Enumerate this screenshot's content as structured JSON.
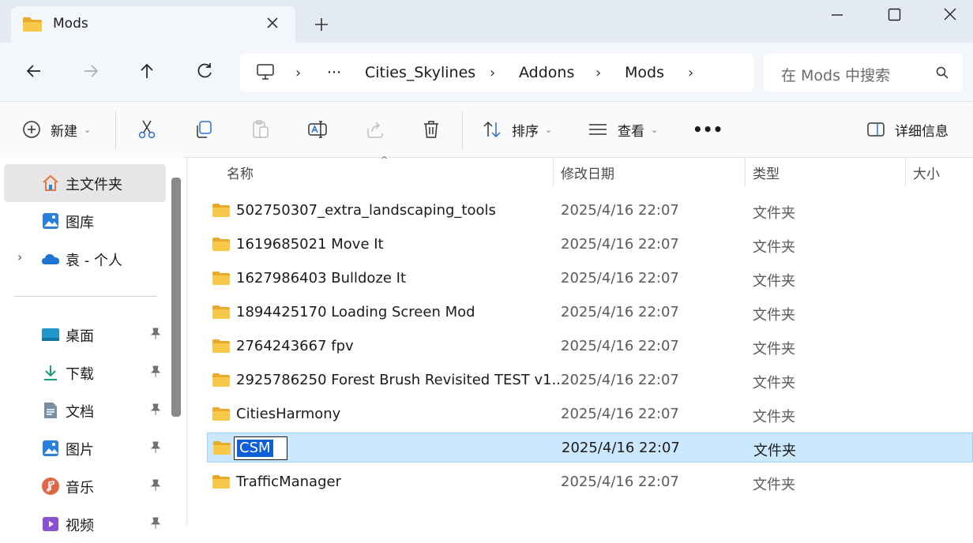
{
  "window": {
    "tab_title": "Mods",
    "controls": [
      "minimize-icon",
      "maximize-icon",
      "close-icon"
    ]
  },
  "address": {
    "ellipsis": "···",
    "crumbs": [
      "Cities_Skylines",
      "Addons",
      "Mods"
    ],
    "search_placeholder": "在 Mods 中搜索"
  },
  "toolbar": {
    "new_label": "新建",
    "sort_label": "排序",
    "view_label": "查看",
    "more_label": "•••",
    "details_label": "详细信息"
  },
  "sidebar": {
    "items": [
      {
        "label": "主文件夹",
        "icon": "home-icon"
      },
      {
        "label": "图库",
        "icon": "gallery-icon"
      },
      {
        "label": "袁 - 个人",
        "icon": "onedrive-icon"
      }
    ],
    "pinned": [
      {
        "label": "桌面",
        "icon": "desktop-icon"
      },
      {
        "label": "下载",
        "icon": "download-icon"
      },
      {
        "label": "文档",
        "icon": "documents-icon"
      },
      {
        "label": "图片",
        "icon": "pictures-icon"
      },
      {
        "label": "音乐",
        "icon": "music-icon"
      },
      {
        "label": "视频",
        "icon": "video-icon"
      }
    ]
  },
  "columns": {
    "name": "名称",
    "modified": "修改日期",
    "type": "类型",
    "size": "大小"
  },
  "files": [
    {
      "name": "502750307_extra_landscaping_tools",
      "modified": "2025/4/16 22:07",
      "type": "文件夹"
    },
    {
      "name": "1619685021 Move It",
      "modified": "2025/4/16 22:07",
      "type": "文件夹"
    },
    {
      "name": "1627986403 Bulldoze It",
      "modified": "2025/4/16 22:07",
      "type": "文件夹"
    },
    {
      "name": "1894425170 Loading Screen Mod",
      "modified": "2025/4/16 22:07",
      "type": "文件夹"
    },
    {
      "name": "2764243667 fpv",
      "modified": "2025/4/16 22:07",
      "type": "文件夹"
    },
    {
      "name": "2925786250 Forest Brush Revisited TEST v1....",
      "modified": "2025/4/16 22:07",
      "type": "文件夹"
    },
    {
      "name": "CitiesHarmony",
      "modified": "2025/4/16 22:07",
      "type": "文件夹"
    },
    {
      "name": "CSM",
      "modified": "2025/4/16 22:07",
      "type": "文件夹"
    },
    {
      "name": "TrafficManager",
      "modified": "2025/4/16 22:07",
      "type": "文件夹"
    }
  ],
  "colors": {
    "accent": "#0f5fd8",
    "selection_bg": "#cce8ff",
    "folder": "#f6c34a"
  }
}
